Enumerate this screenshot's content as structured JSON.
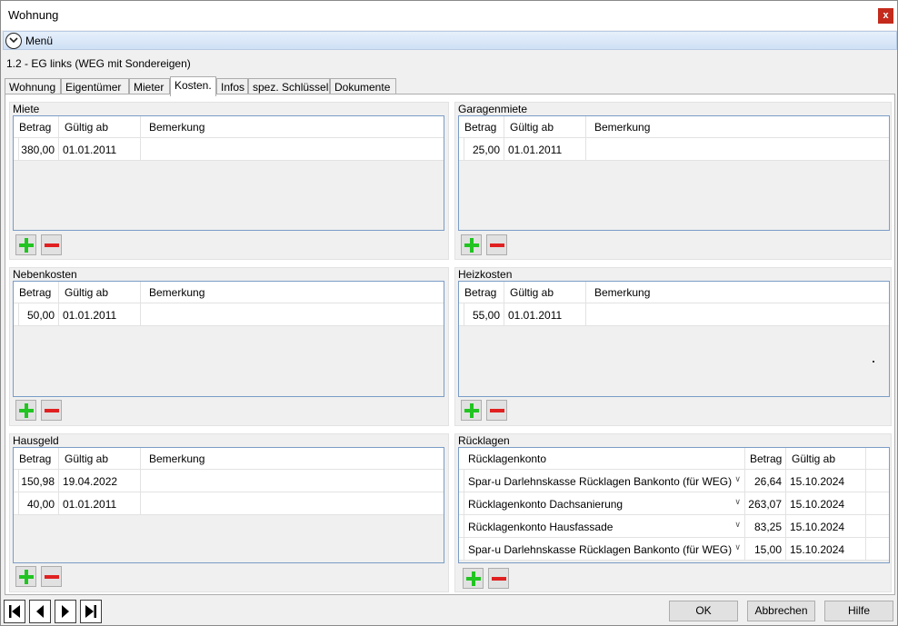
{
  "window": {
    "title": "Wohnung",
    "close_glyph": "x"
  },
  "menu": {
    "label": "Menü",
    "icon": "chevron-down-circle-icon"
  },
  "breadcrumb": "1.2 - EG links (WEG mit Sondereigen)",
  "tabs": [
    "Wohnung",
    "Eigentümer",
    "Mieter",
    "Kosten.",
    "Infos",
    "spez. Schlüssel",
    "Dokumente"
  ],
  "active_tab": "Kosten.",
  "columns": {
    "betrag": "Betrag",
    "gueltig": "Gültig ab",
    "bemerkung": "Bemerkung",
    "konto": "Rücklagenkonto"
  },
  "groups": {
    "miete": {
      "title": "Miete",
      "rows": [
        {
          "betrag": "380,00",
          "gueltig": "01.01.2011",
          "bemerkung": ""
        }
      ]
    },
    "garagenmiete": {
      "title": "Garagenmiete",
      "rows": [
        {
          "betrag": "25,00",
          "gueltig": "01.01.2011",
          "bemerkung": ""
        }
      ]
    },
    "nebenkosten": {
      "title": "Nebenkosten",
      "rows": [
        {
          "betrag": "50,00",
          "gueltig": "01.01.2011",
          "bemerkung": ""
        }
      ]
    },
    "heizkosten": {
      "title": "Heizkosten",
      "rows": [
        {
          "betrag": "55,00",
          "gueltig": "01.01.2011",
          "bemerkung": ""
        }
      ]
    },
    "hausgeld": {
      "title": "Hausgeld",
      "rows": [
        {
          "betrag": "150,98",
          "gueltig": "19.04.2022",
          "bemerkung": ""
        },
        {
          "betrag": "40,00",
          "gueltig": "01.01.2011",
          "bemerkung": ""
        }
      ]
    },
    "ruecklagen": {
      "title": "Rücklagen",
      "rows": [
        {
          "konto": "Spar-u Darlehnskasse Rücklagen Bankonto  (für WEG)",
          "betrag": "26,64",
          "gueltig": "15.10.2024"
        },
        {
          "konto": "Rücklagenkonto Dachsanierung",
          "betrag": "263,07",
          "gueltig": "15.10.2024"
        },
        {
          "konto": "Rücklagenkonto Hausfassade",
          "betrag": "83,25",
          "gueltig": "15.10.2024"
        },
        {
          "konto": "Spar-u Darlehnskasse Rücklagen Bankonto  (für WEG)",
          "betrag": "15,00",
          "gueltig": "15.10.2024"
        }
      ]
    }
  },
  "buttons": {
    "ok": "OK",
    "cancel": "Abbrechen",
    "help": "Hilfe"
  },
  "nav_icons": [
    "first-record-icon",
    "previous-record-icon",
    "next-record-icon",
    "last-record-icon"
  ],
  "colors": {
    "add_green": "#22c422",
    "remove_red": "#e02020",
    "grid_border": "#7a9cc6",
    "menu_bar": "#d6e5f7",
    "close_red": "#c42b1c"
  }
}
